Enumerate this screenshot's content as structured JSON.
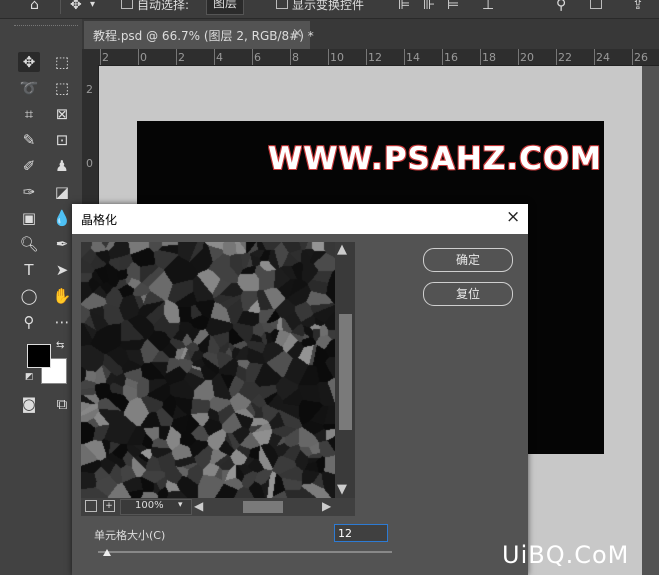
{
  "options_bar": {
    "auto_select_label": "自动选择:",
    "auto_select_value": "图层",
    "show_transform_label": "显示变换控件"
  },
  "tab": {
    "title": "教程.psd @ 66.7% (图层 2, RGB/8#) *",
    "close": "×"
  },
  "rulers": {
    "h": [
      "2",
      "0",
      "2",
      "4",
      "6",
      "8",
      "10",
      "12",
      "14",
      "16",
      "18",
      "20",
      "22",
      "24",
      "26"
    ],
    "v": [
      "2",
      "0",
      "2"
    ]
  },
  "document": {
    "text": "WWW.PSAHZ.COM"
  },
  "dialog": {
    "title": "晶格化",
    "close": "×",
    "ok_label": "确定",
    "reset_label": "复位",
    "zoom": "100%",
    "cell_size_label": "单元格大小(C)",
    "cell_size_value": "12",
    "cell_size_min": 3,
    "cell_size_max": 300
  },
  "watermark": "UiBQ.CoM",
  "colors": {
    "foreground": "#000000",
    "background": "#ffffff",
    "title_outline": "#c8393a"
  }
}
